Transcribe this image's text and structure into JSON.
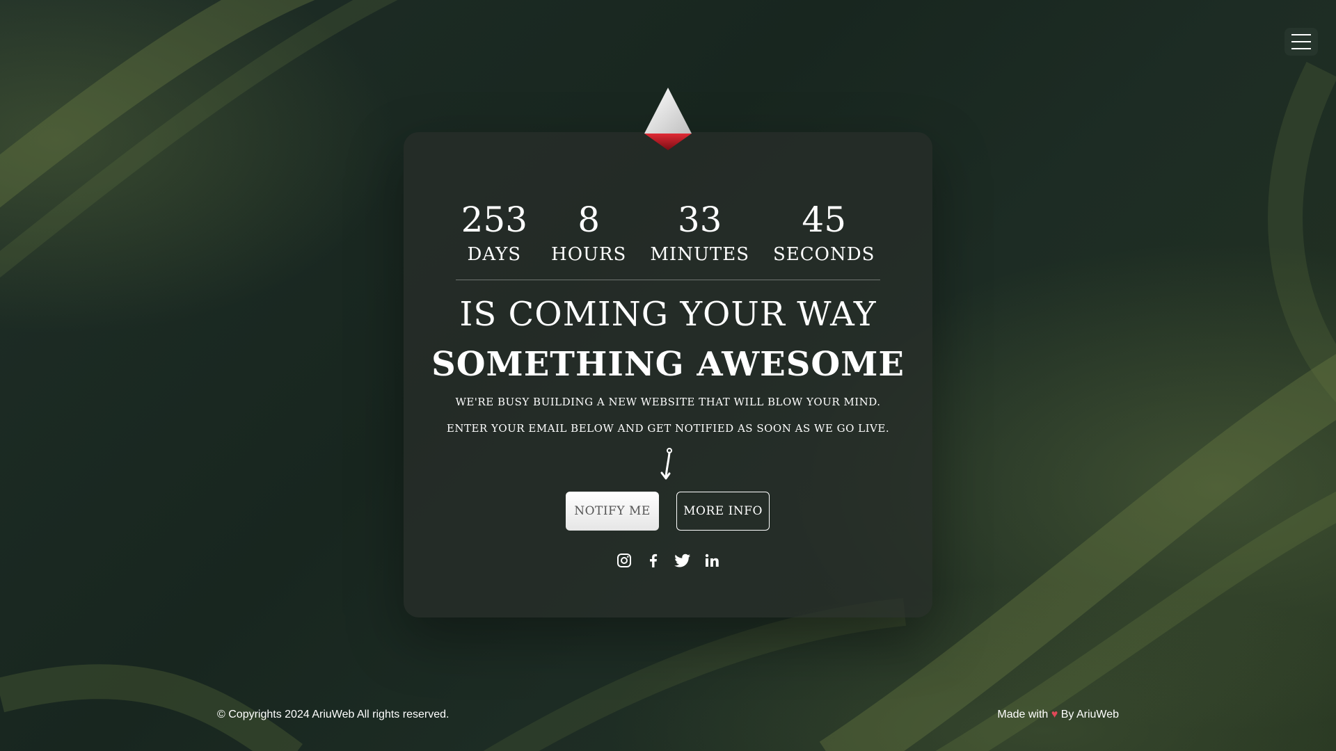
{
  "menu": {
    "icon": "hamburger-menu-icon"
  },
  "logo": {
    "icon": "triangle-logo-icon",
    "colors": {
      "top": "#ffffff",
      "bottom": "#c0202a"
    }
  },
  "countdown": [
    {
      "value": "253",
      "label": "DAYS"
    },
    {
      "value": "8",
      "label": "HOURS"
    },
    {
      "value": "33",
      "label": "MINUTES"
    },
    {
      "value": "45",
      "label": "SECONDS"
    }
  ],
  "headline": {
    "line1": "IS COMING YOUR WAY",
    "line2": "SOMETHING AWESOME"
  },
  "subtext": {
    "line1": "WE'RE BUSY BUILDING A NEW WEBSITE THAT WILL BLOW YOUR MIND.",
    "line2": "ENTER YOUR EMAIL BELOW AND GET NOTIFIED AS SOON AS WE GO LIVE."
  },
  "arrow": {
    "icon": "down-arrow-icon"
  },
  "buttons": {
    "notify_label": "NOTIFY ME",
    "more_info_label": "MORE INFO"
  },
  "social": [
    {
      "name": "instagram",
      "icon": "instagram-icon"
    },
    {
      "name": "facebook",
      "icon": "facebook-icon"
    },
    {
      "name": "twitter",
      "icon": "twitter-icon"
    },
    {
      "name": "linkedin",
      "icon": "linkedin-icon"
    }
  ],
  "footer": {
    "copyright": "© Copyrights 2024 AriuWeb All rights reserved.",
    "made_with": "Made with",
    "heart_icon": "heart-icon",
    "by": "By",
    "brand": "AriuWeb"
  },
  "colors": {
    "background": "#1c2a25",
    "accent_red": "#c0202a",
    "heart": "#e04858",
    "text": "#ffffff"
  }
}
